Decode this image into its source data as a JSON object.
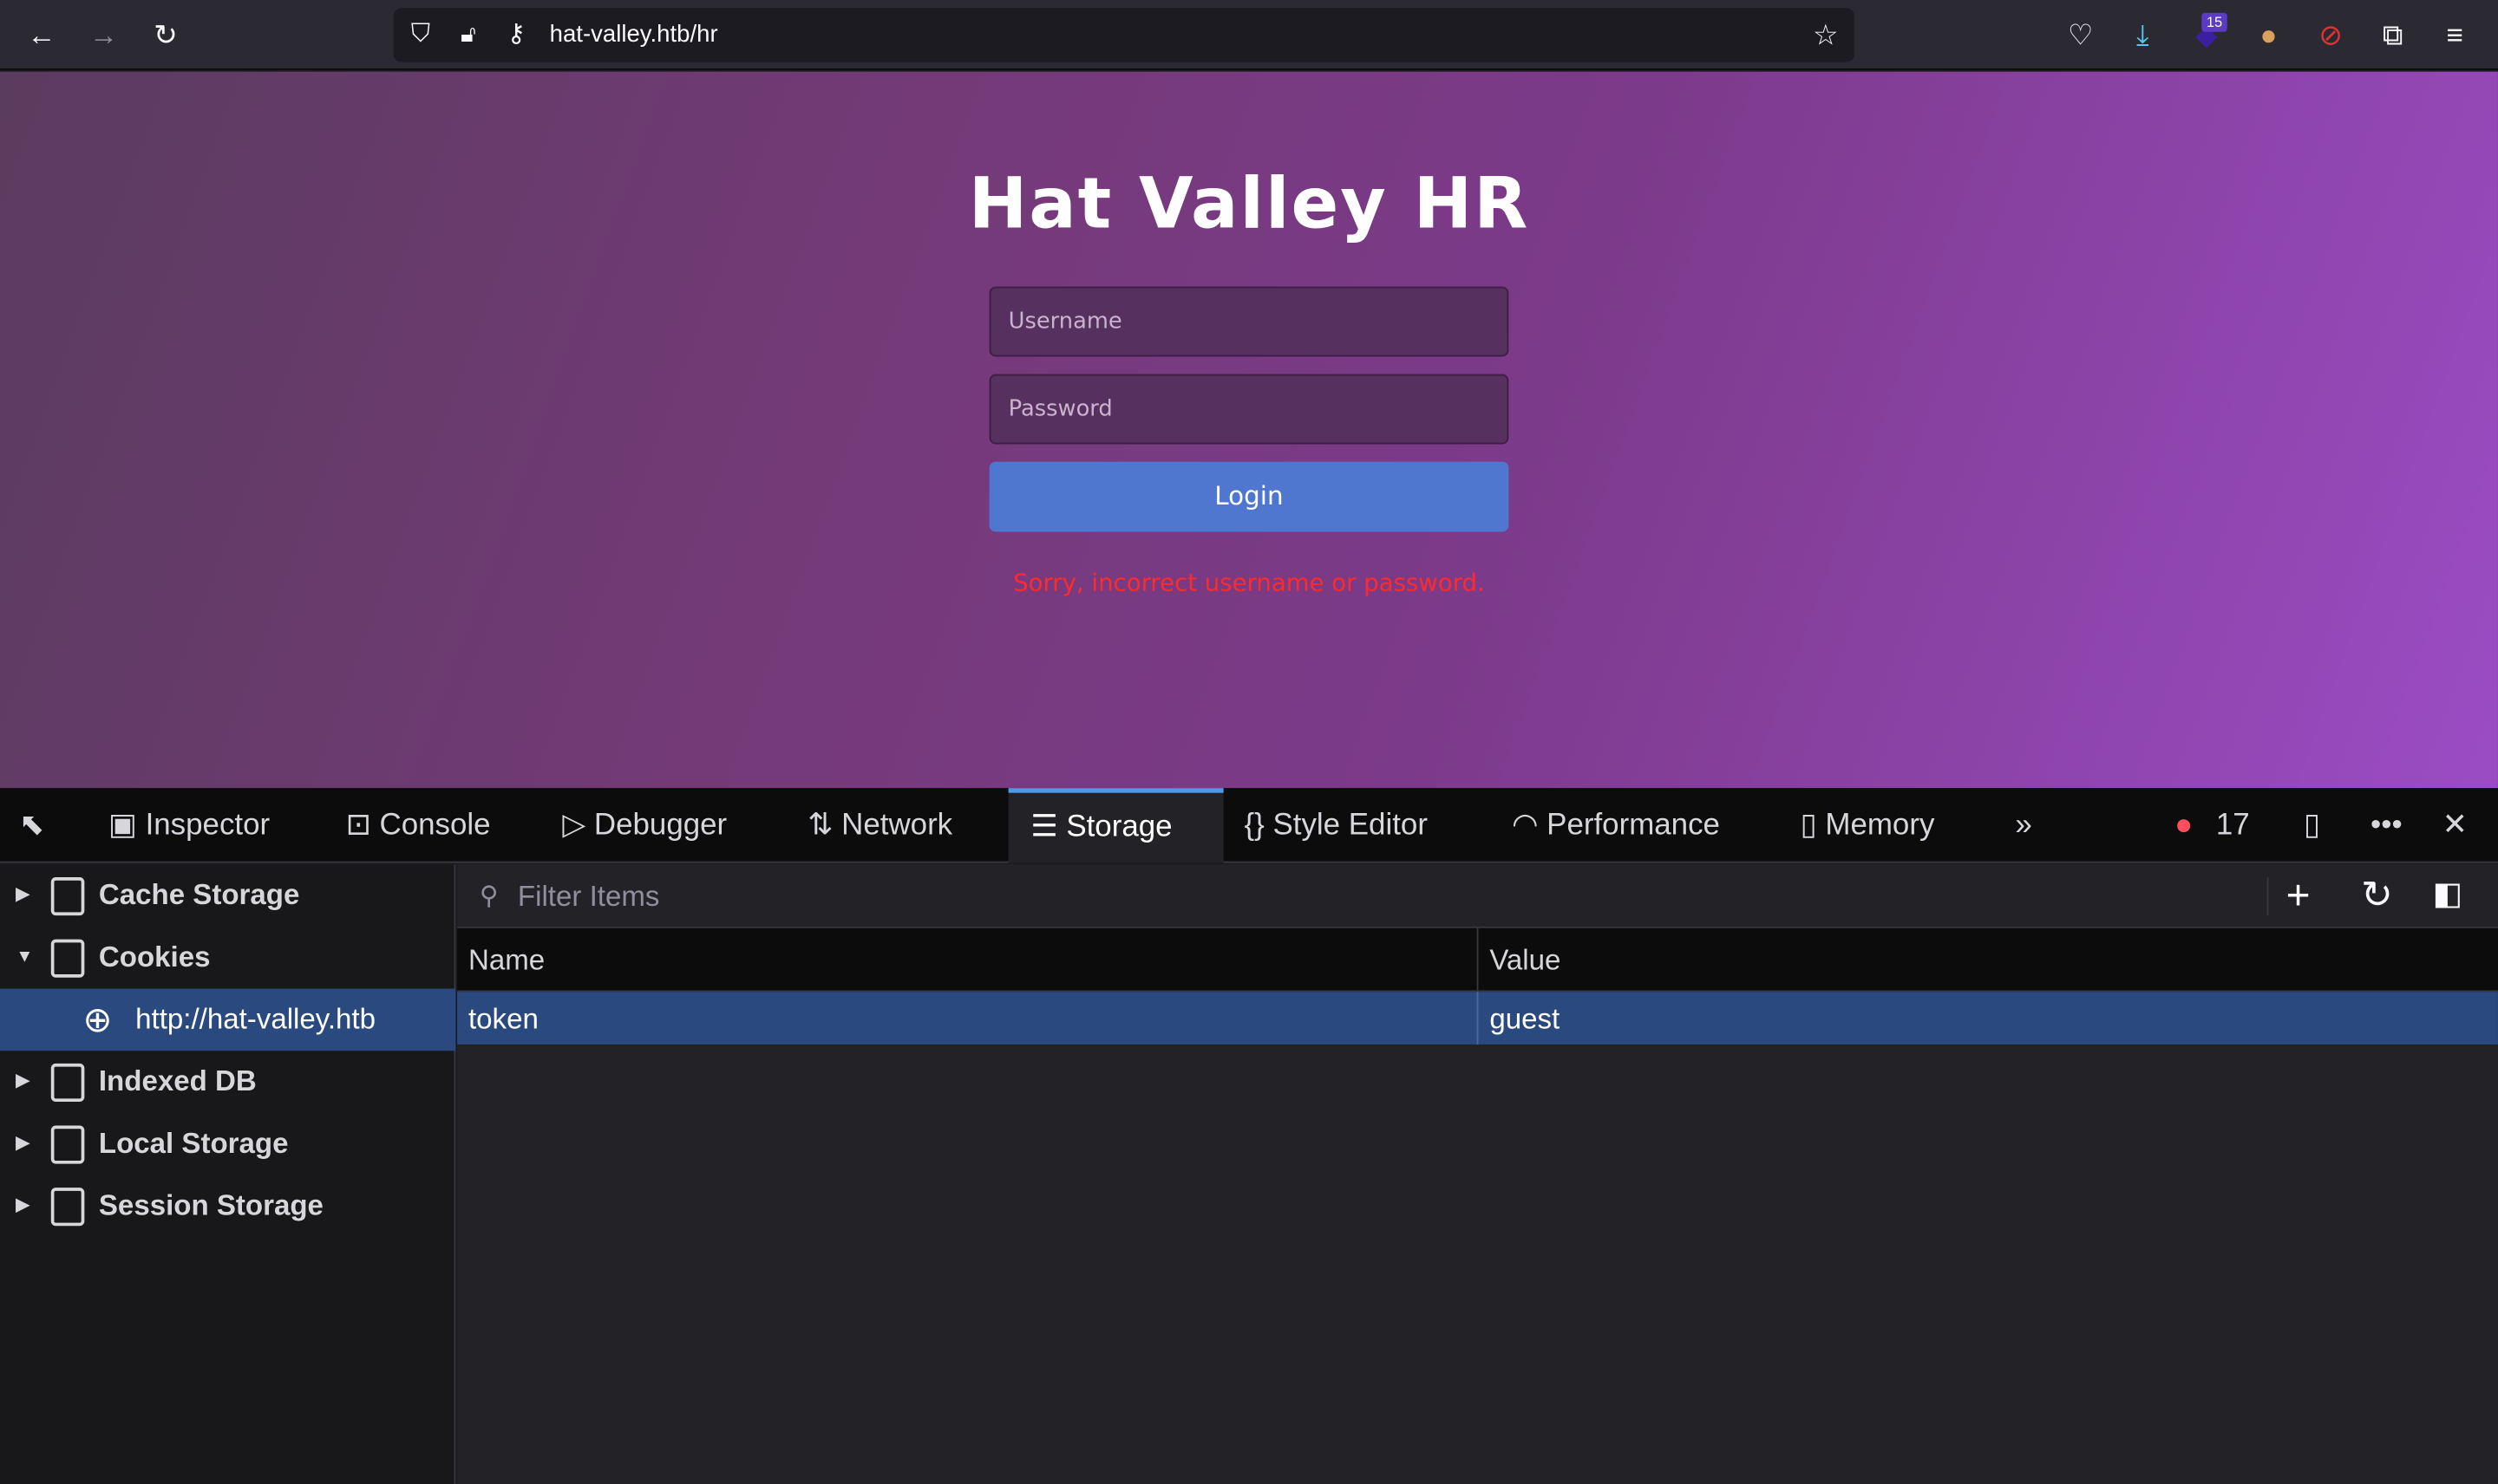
{
  "browser": {
    "url": "hat-valley.htb/hr",
    "extension_badge": "15",
    "icons": [
      "back-icon",
      "forward-icon",
      "reload-icon",
      "shield-icon",
      "lock-warning-icon",
      "key-icon",
      "star-icon",
      "pocket-icon",
      "download-icon",
      "extension-stack-icon",
      "cookie-icon",
      "blocked-fox-icon",
      "puzzle-icon",
      "menu-icon"
    ]
  },
  "page": {
    "title": "Hat Valley HR",
    "username_placeholder": "Username",
    "password_placeholder": "Password",
    "login_label": "Login",
    "error": "Sorry, incorrect username or password.",
    "colors": {
      "button": "#5077d0",
      "error": "#ff2a2a"
    }
  },
  "devtools": {
    "tabs": [
      "Inspector",
      "Console",
      "Debugger",
      "Network",
      "Storage",
      "Style Editor",
      "Performance",
      "Memory"
    ],
    "selected_tab": "Storage",
    "error_count": "17",
    "sidebar": [
      {
        "label": "Cache Storage",
        "expanded": false
      },
      {
        "label": "Cookies",
        "expanded": true
      },
      {
        "label": "http://hat-valley.htb",
        "child": true
      },
      {
        "label": "Indexed DB",
        "expanded": false
      },
      {
        "label": "Local Storage",
        "expanded": false
      },
      {
        "label": "Session Storage",
        "expanded": false
      }
    ],
    "filter_placeholder": "Filter Items",
    "columns": [
      "Name",
      "Value"
    ],
    "rows": [
      {
        "name": "token",
        "value": "guest"
      }
    ]
  }
}
